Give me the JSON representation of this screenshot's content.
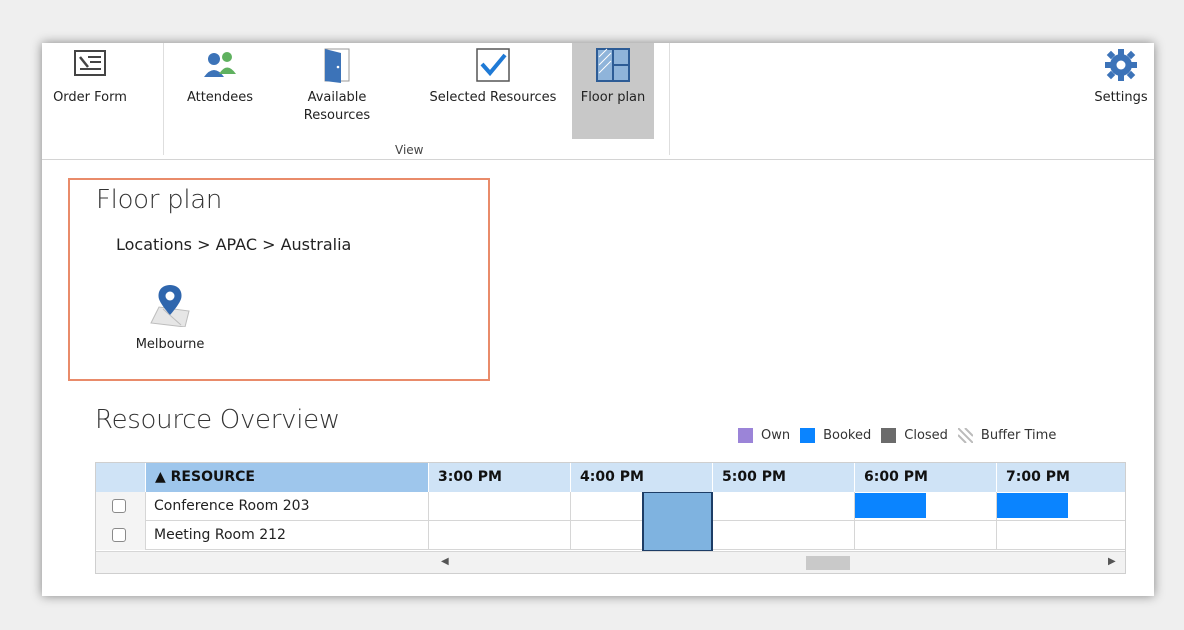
{
  "ribbon": {
    "buttons": [
      {
        "label": "Order Form",
        "icon": "order-form-icon"
      },
      {
        "label": "Attendees",
        "icon": "attendees-icon"
      },
      {
        "label": "Available Resources",
        "label_line1": "Available",
        "label_line2": "Resources",
        "icon": "door-icon"
      },
      {
        "label": "Selected Resources",
        "icon": "checkbox-icon"
      },
      {
        "label": "Floor plan",
        "icon": "floor-plan-icon",
        "active": true
      },
      {
        "label": "Settings",
        "icon": "gear-icon"
      }
    ],
    "group_label": "View"
  },
  "floor_plan": {
    "title": "Floor plan",
    "breadcrumb": "Locations > APAC > Australia",
    "location": {
      "label": "Melbourne",
      "icon": "map-pin-icon"
    }
  },
  "resource_overview": {
    "title": "Resource Overview",
    "legend": [
      {
        "label": "Own",
        "color": "#9b84d8"
      },
      {
        "label": "Booked",
        "color": "#0a84ff"
      },
      {
        "label": "Closed",
        "color": "#6b6b6b"
      },
      {
        "label": "Buffer Time",
        "color": "#d9d9d9"
      }
    ],
    "columns": {
      "resource": "▲ RESOURCE",
      "times": [
        "3:00 PM",
        "4:00 PM",
        "5:00 PM",
        "6:00 PM",
        "7:00 PM"
      ]
    },
    "rows": [
      {
        "name": "Conference Room 203"
      },
      {
        "name": "Meeting Room 212"
      }
    ]
  },
  "colors": {
    "accent": "#0a84ff",
    "header_bg": "#cfe3f6",
    "selection_border": "#e98b6a"
  }
}
